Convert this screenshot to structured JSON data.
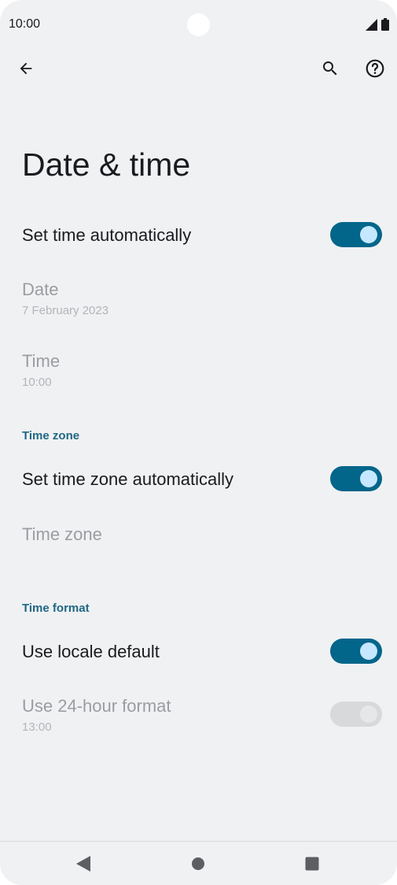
{
  "status_bar": {
    "time": "10:00",
    "icons": [
      "signal-icon",
      "battery-icon"
    ]
  },
  "app_bar": {
    "icons": [
      "back-arrow-icon",
      "search-icon",
      "help-icon"
    ]
  },
  "page": {
    "title": "Date & time"
  },
  "settings": {
    "set_time_auto": {
      "label": "Set time automatically",
      "toggle": "on"
    },
    "date": {
      "label": "Date",
      "value": "7 February 2023"
    },
    "time": {
      "label": "Time",
      "value": "10:00"
    },
    "time_zone_header": "Time zone",
    "set_time_zone_auto": {
      "label": "Set time zone automatically",
      "toggle": "on"
    },
    "time_zone": {
      "label": "Time zone"
    },
    "time_format_header": "Time format",
    "use_locale_default": {
      "label": "Use locale default",
      "toggle": "on"
    },
    "use_24_hour": {
      "label": "Use 24-hour format",
      "value": "13:00",
      "toggle": "off-disabled"
    }
  },
  "nav_bar": {
    "icons": [
      "back-triangle-icon",
      "home-circle-icon",
      "recents-square-icon"
    ]
  },
  "colors": {
    "accent": "#02658a",
    "thumb": "#c5e7ff",
    "section": "#1f6784",
    "background": "#f0f1f3"
  }
}
